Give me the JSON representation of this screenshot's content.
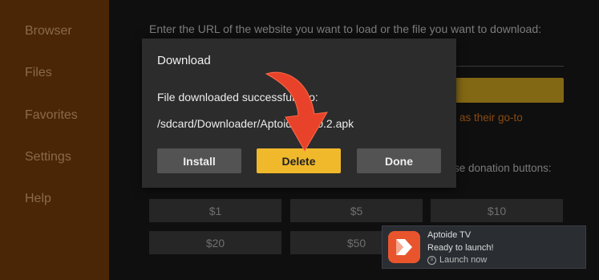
{
  "sidebar": {
    "items": [
      {
        "label": "Browser"
      },
      {
        "label": "Files"
      },
      {
        "label": "Favorites"
      },
      {
        "label": "Settings"
      },
      {
        "label": "Help"
      }
    ]
  },
  "main": {
    "prompt": "Enter the URL of the website you want to load or the file you want to download:",
    "hint": "as their go-to",
    "donation_text": "se donation buttons:",
    "donations": [
      "$1",
      "$5",
      "$10",
      "$20",
      "$50"
    ]
  },
  "dialog": {
    "title": "Download",
    "message": "File downloaded successfully to:",
    "path": "/sdcard/Downloader/Aptoide...5.0.2.apk",
    "buttons": {
      "install": "Install",
      "delete": "Delete",
      "done": "Done"
    }
  },
  "toast": {
    "app": "Aptoide TV",
    "status": "Ready to launch!",
    "action": "Launch now"
  },
  "colors": {
    "sidebar": "#4a2607",
    "accent": "#f0b92b",
    "arrow": "#e8432a"
  }
}
